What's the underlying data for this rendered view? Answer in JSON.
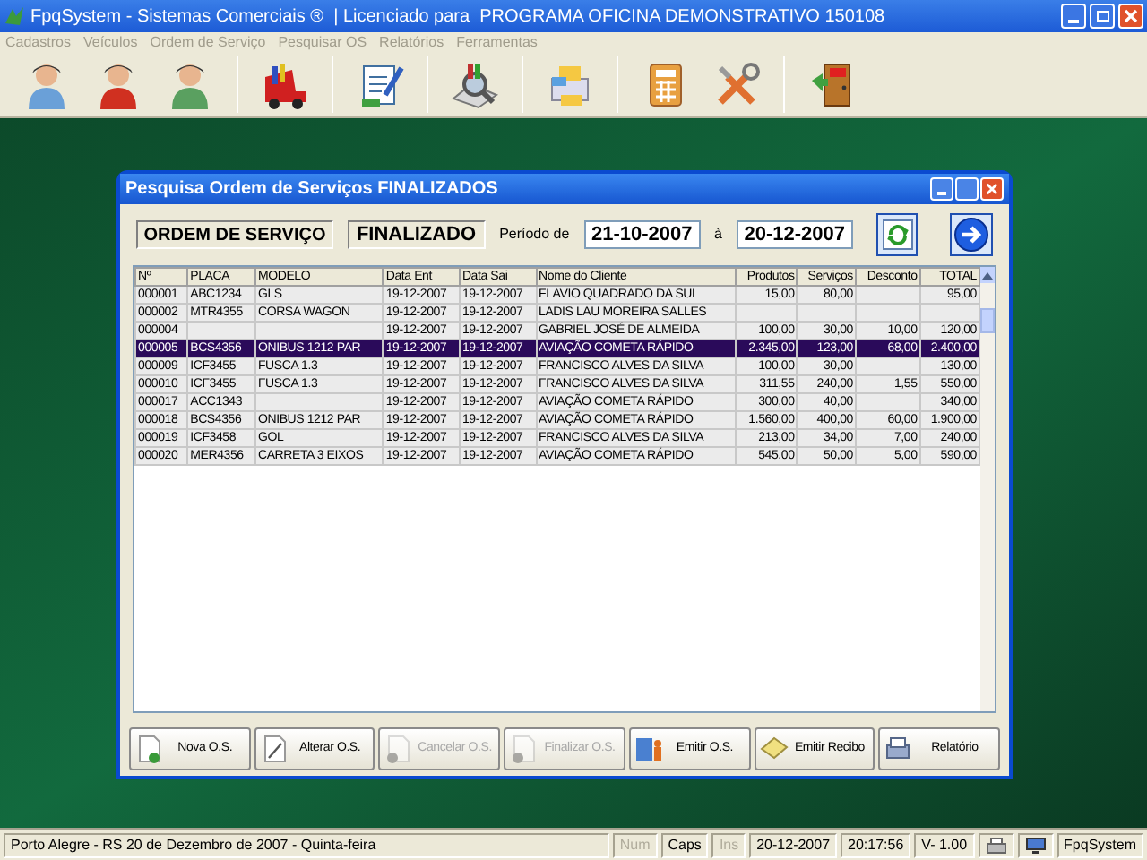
{
  "window": {
    "title": "FpqSystem - Sistemas Comerciais ®  | Licenciado para  PROGRAMA OFICINA DEMONSTRATIVO 150108"
  },
  "menu": [
    "Cadastros",
    "Veículos",
    "Ordem de Serviço",
    "Pesquisar OS",
    "Relatórios",
    "Ferramentas"
  ],
  "dialog": {
    "title": "Pesquisa Ordem de Serviços FINALIZADOS",
    "header": {
      "order_label": "ORDEM DE SERVIÇO",
      "status_label": "FINALIZADO",
      "period_label": "Período de",
      "date_from": "21-10-2007",
      "to_label": "à",
      "date_to": "20-12-2007"
    },
    "table": {
      "columns": [
        "Nº",
        "PLACA",
        "MODELO",
        "Data Ent",
        "Data Sai",
        "Nome do Cliente",
        "Produtos",
        "Serviços",
        "Desconto",
        "TOTAL"
      ],
      "rows": [
        {
          "selected": false,
          "cells": [
            "000001",
            "ABC1234",
            "GLS",
            "19-12-2007",
            "19-12-2007",
            "FLAVIO QUADRADO DA SUL",
            "15,00",
            "80,00",
            null,
            "95,00"
          ]
        },
        {
          "selected": false,
          "cells": [
            "000002",
            "MTR4355",
            "CORSA WAGON",
            "19-12-2007",
            "19-12-2007",
            "LADIS LAU MOREIRA SALLES",
            null,
            null,
            null,
            null
          ]
        },
        {
          "selected": false,
          "cells": [
            "000004",
            null,
            null,
            "19-12-2007",
            "19-12-2007",
            "GABRIEL JOSÉ DE ALMEIDA",
            "100,00",
            "30,00",
            "10,00",
            "120,00"
          ]
        },
        {
          "selected": true,
          "cells": [
            "000005",
            "BCS4356",
            "ONIBUS 1212 PAR",
            "19-12-2007",
            "19-12-2007",
            "AVIAÇÃO COMETA RÁPIDO",
            "2.345,00",
            "123,00",
            "68,00",
            "2.400,00"
          ]
        },
        {
          "selected": false,
          "cells": [
            "000009",
            "ICF3455",
            "FUSCA 1.3",
            "19-12-2007",
            "19-12-2007",
            "FRANCISCO ALVES DA SILVA",
            "100,00",
            "30,00",
            null,
            "130,00"
          ]
        },
        {
          "selected": false,
          "cells": [
            "000010",
            "ICF3455",
            "FUSCA 1.3",
            "19-12-2007",
            "19-12-2007",
            "FRANCISCO ALVES DA SILVA",
            "311,55",
            "240,00",
            "1,55",
            "550,00"
          ]
        },
        {
          "selected": false,
          "cells": [
            "000017",
            "ACC1343",
            null,
            "19-12-2007",
            "19-12-2007",
            "AVIAÇÃO COMETA RÁPIDO",
            "300,00",
            "40,00",
            null,
            "340,00"
          ]
        },
        {
          "selected": false,
          "cells": [
            "000018",
            "BCS4356",
            "ONIBUS 1212 PAR",
            "19-12-2007",
            "19-12-2007",
            "AVIAÇÃO COMETA RÁPIDO",
            "1.560,00",
            "400,00",
            "60,00",
            "1.900,00"
          ]
        },
        {
          "selected": false,
          "cells": [
            "000019",
            "ICF3458",
            "GOL",
            "19-12-2007",
            "19-12-2007",
            "FRANCISCO ALVES DA SILVA",
            "213,00",
            "34,00",
            "7,00",
            "240,00"
          ]
        },
        {
          "selected": false,
          "cells": [
            "000020",
            "MER4356",
            "CARRETA 3 EIXOS",
            "19-12-2007",
            "19-12-2007",
            "AVIAÇÃO COMETA RÁPIDO",
            "545,00",
            "50,00",
            "5,00",
            "590,00"
          ]
        }
      ]
    },
    "buttons": [
      {
        "label": "Nova O.S.",
        "kind": "new",
        "disabled": false
      },
      {
        "label": "Alterar O.S.",
        "kind": "edit",
        "disabled": false
      },
      {
        "label": "Cancelar O.S.",
        "kind": "cancel",
        "disabled": true
      },
      {
        "label": "Finalizar O.S.",
        "kind": "finish",
        "disabled": true
      },
      {
        "label": "Emitir O.S.",
        "kind": "issue",
        "disabled": false
      },
      {
        "label": "Emitir Recibo",
        "kind": "receipt",
        "disabled": false
      },
      {
        "label": "Relatório",
        "kind": "report",
        "disabled": false
      }
    ]
  },
  "status_bar": {
    "location": "Porto Alegre - RS 20 de Dezembro de 2007 - Quinta-feira",
    "keys": [
      {
        "label": "Num",
        "on": false
      },
      {
        "label": "Caps",
        "on": true
      },
      {
        "label": "Ins",
        "on": false
      }
    ],
    "date": "20-12-2007",
    "time": "20:17:56",
    "version": "V-  1.00",
    "app": "FpqSystem"
  }
}
